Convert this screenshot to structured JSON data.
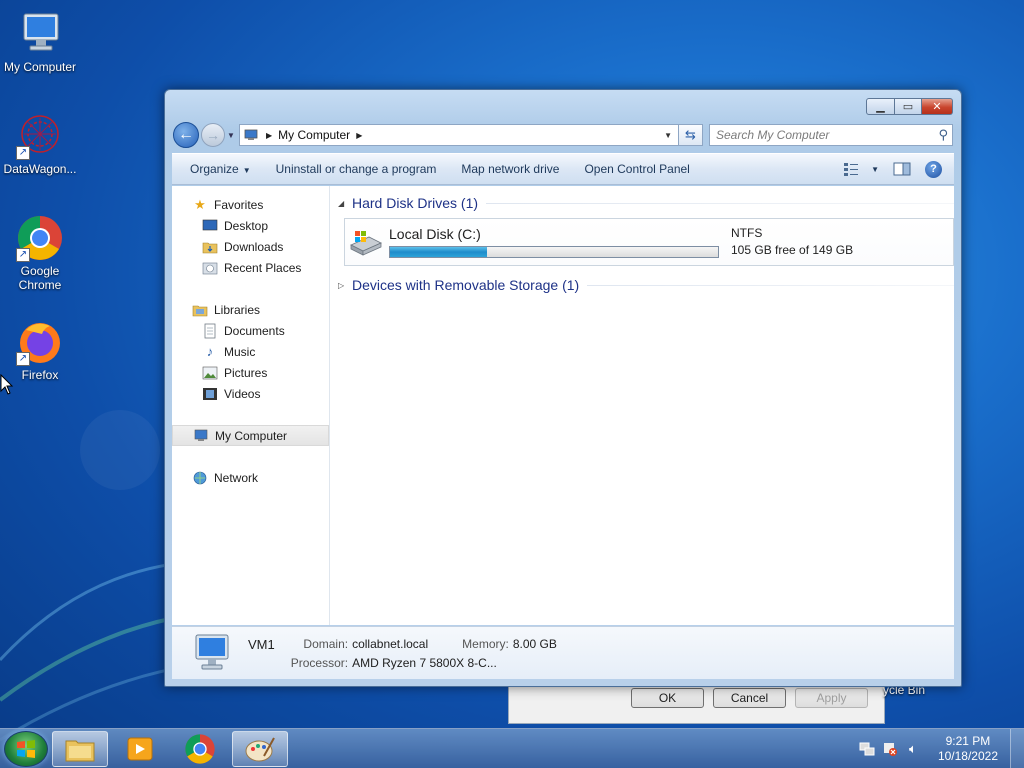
{
  "desktop": {
    "icons": [
      {
        "label": "My Computer"
      },
      {
        "label": "DataWagon..."
      },
      {
        "label": "Google Chrome"
      },
      {
        "label": "Firefox"
      }
    ],
    "recycle_bin_partial": "ycle Bin"
  },
  "window": {
    "address": {
      "path": "My Computer"
    },
    "search": {
      "placeholder": "Search My Computer"
    },
    "toolbar": {
      "organize": "Organize",
      "uninstall": "Uninstall or change a program",
      "map_drive": "Map network drive",
      "control_panel": "Open Control Panel"
    },
    "nav_pane": {
      "favorites": "Favorites",
      "desktop": "Desktop",
      "downloads": "Downloads",
      "recent_places": "Recent Places",
      "libraries": "Libraries",
      "documents": "Documents",
      "music": "Music",
      "pictures": "Pictures",
      "videos": "Videos",
      "my_computer": "My Computer",
      "network": "Network"
    },
    "groups": {
      "hard_disk": "Hard Disk Drives (1)",
      "removable": "Devices with Removable Storage (1)"
    },
    "drive": {
      "name": "Local Disk (C:)",
      "filesystem": "NTFS",
      "space": "105 GB free of 149 GB",
      "used_fraction": 0.295
    },
    "details": {
      "computer_name": "VM1",
      "domain_label": "Domain:",
      "domain_value": "collabnet.local",
      "memory_label": "Memory:",
      "memory_value": "8.00 GB",
      "processor_label": "Processor:",
      "processor_value": "AMD Ryzen 7 5800X 8-C..."
    }
  },
  "background_dialog": {
    "ok": "OK",
    "cancel": "Cancel",
    "apply": "Apply"
  },
  "taskbar": {
    "time": "9:21 PM",
    "date": "10/18/2022"
  }
}
